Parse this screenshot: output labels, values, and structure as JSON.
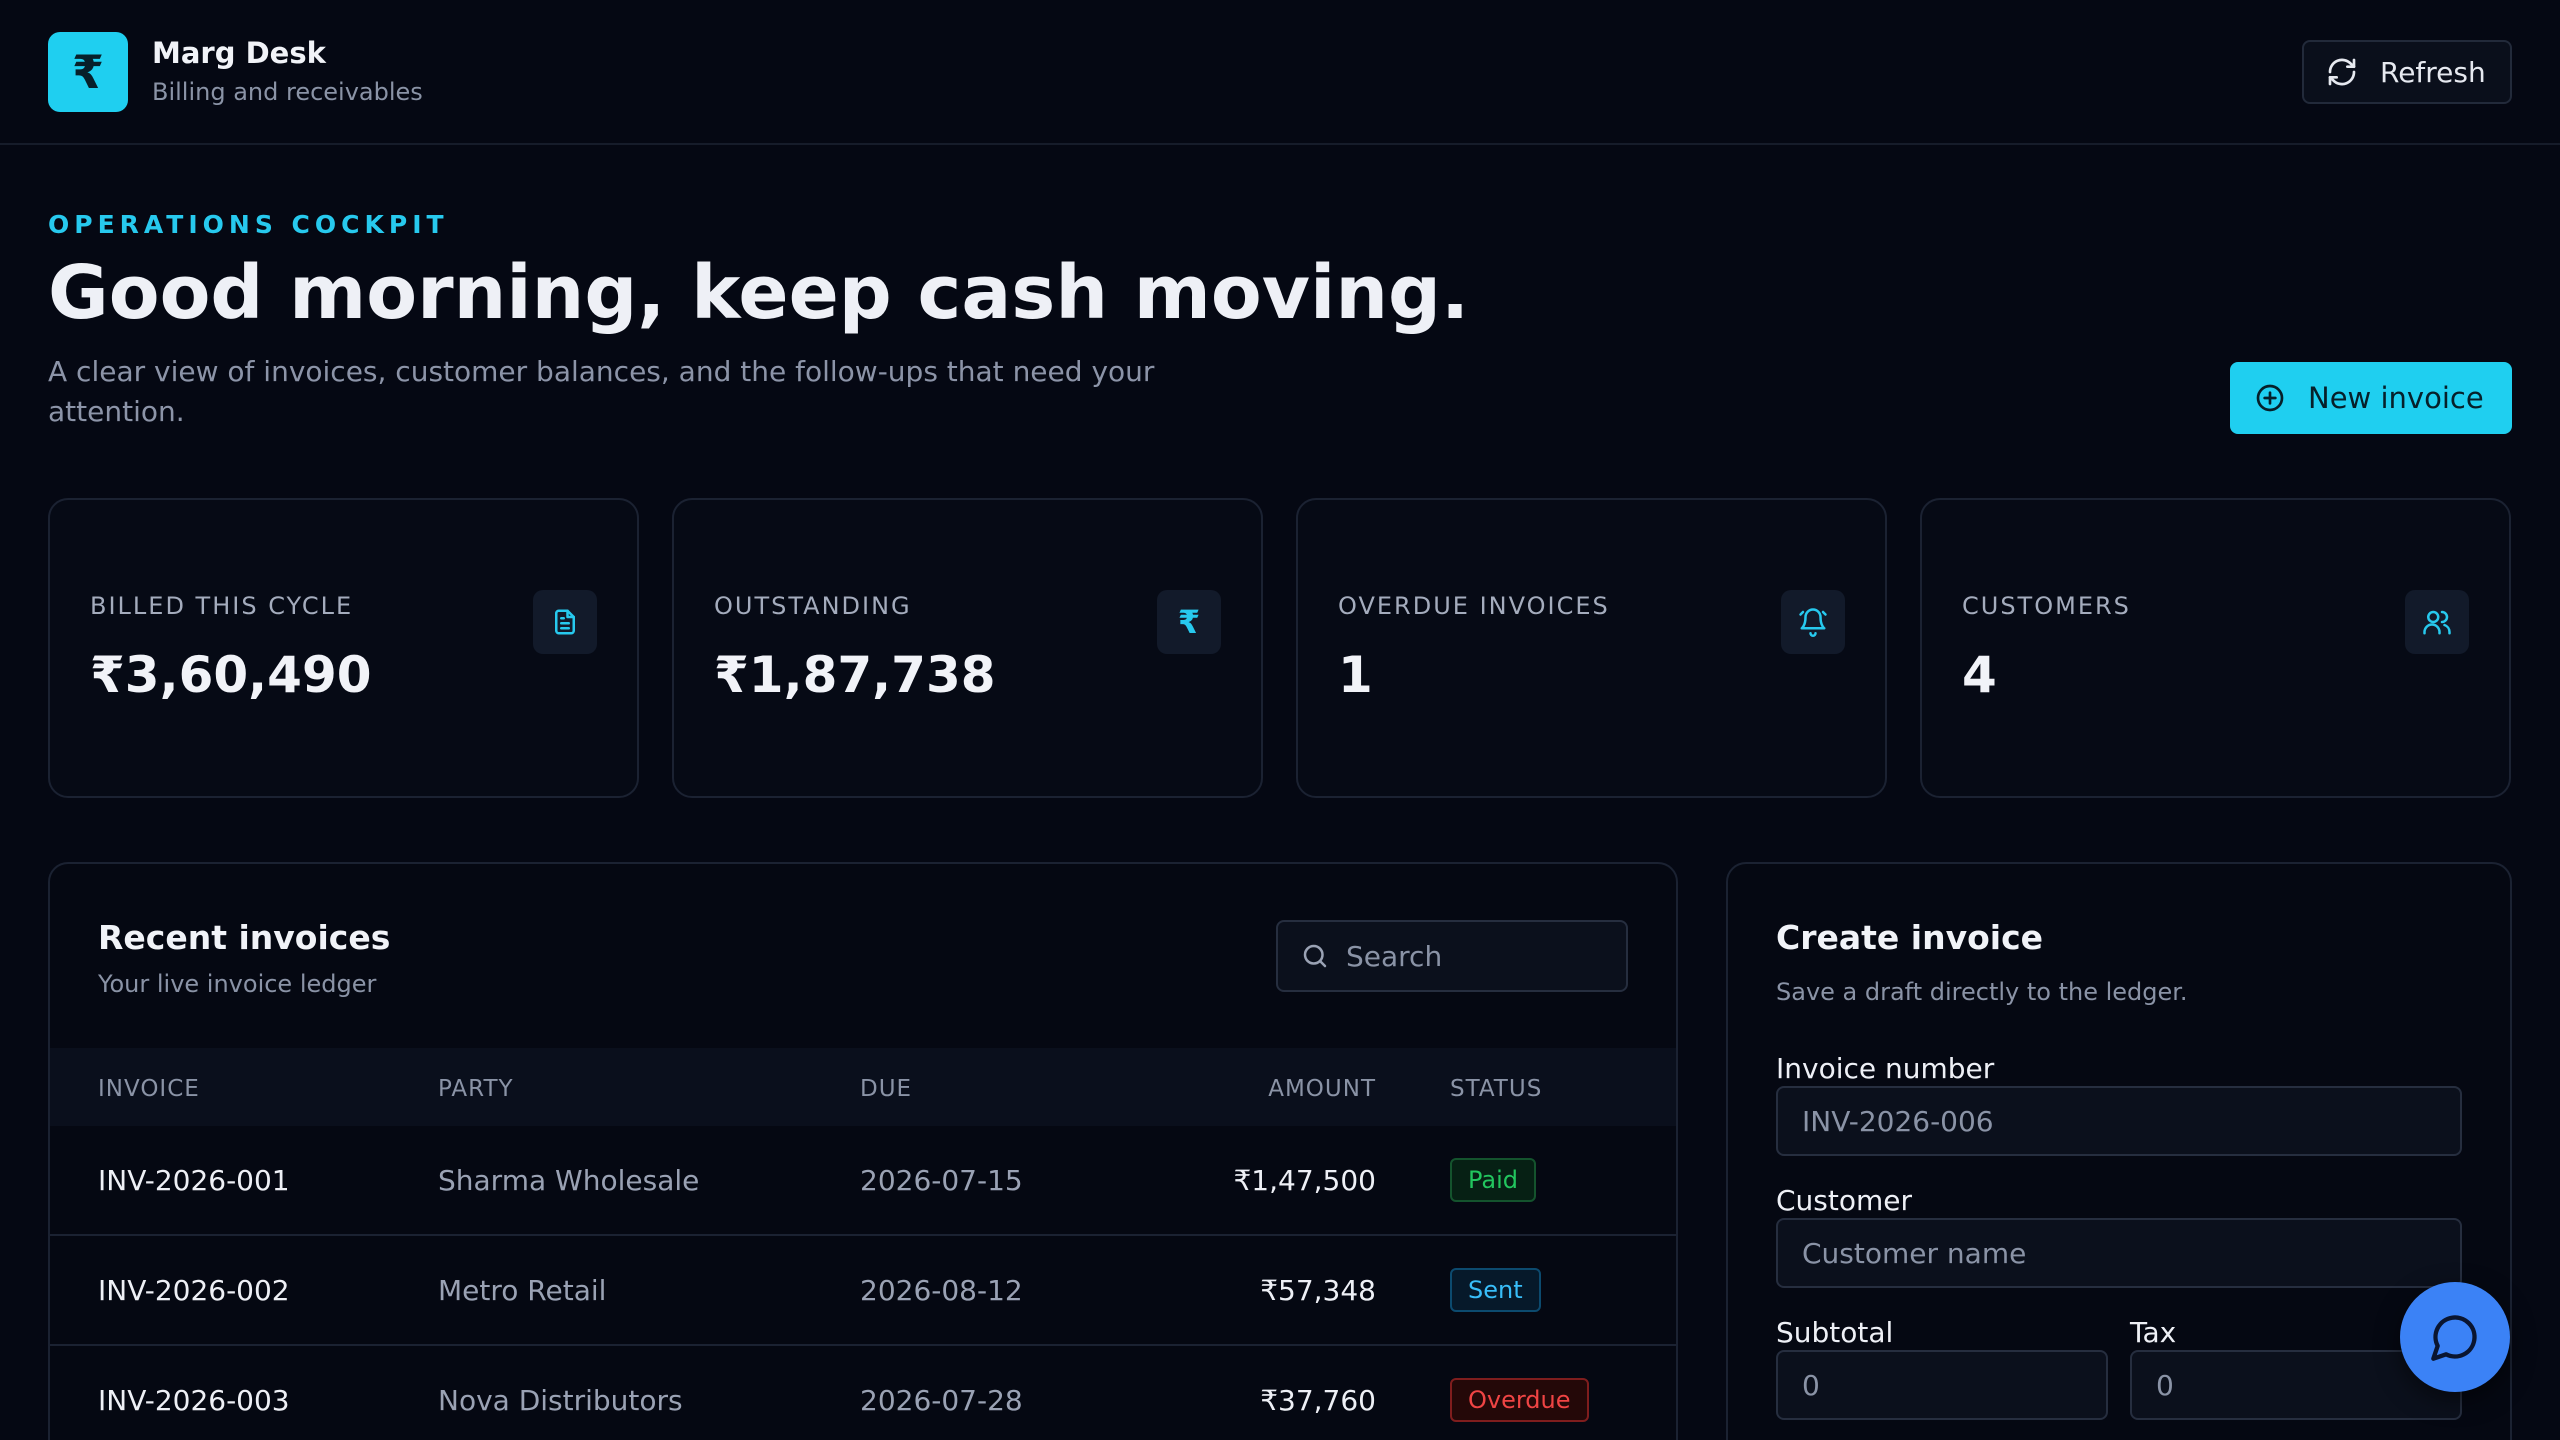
{
  "app": {
    "name": "Marg Desk",
    "subtitle": "Billing and receivables",
    "logo_glyph": "₹",
    "refresh_label": "Refresh"
  },
  "hero": {
    "eyebrow": "OPERATIONS COCKPIT",
    "title": "Good morning, keep cash moving.",
    "description": "A clear view of invoices, customer balances, and the follow-ups that need your attention.",
    "new_invoice_label": "New invoice"
  },
  "stats": [
    {
      "label": "BILLED THIS CYCLE",
      "value": "₹3,60,490",
      "icon": "document-icon"
    },
    {
      "label": "OUTSTANDING",
      "value": "₹1,87,738",
      "icon": "rupee-icon"
    },
    {
      "label": "OVERDUE INVOICES",
      "value": "1",
      "icon": "bell-icon"
    },
    {
      "label": "CUSTOMERS",
      "value": "4",
      "icon": "users-icon"
    }
  ],
  "invoices": {
    "title": "Recent invoices",
    "subtitle": "Your live invoice ledger",
    "search_placeholder": "Search",
    "columns": {
      "invoice": "INVOICE",
      "party": "PARTY",
      "due": "DUE",
      "amount": "AMOUNT",
      "status": "STATUS"
    },
    "rows": [
      {
        "invoice": "INV-2026-001",
        "party": "Sharma Wholesale",
        "due": "2026-07-15",
        "amount": "₹1,47,500",
        "status": "Paid"
      },
      {
        "invoice": "INV-2026-002",
        "party": "Metro Retail",
        "due": "2026-08-12",
        "amount": "₹57,348",
        "status": "Sent"
      },
      {
        "invoice": "INV-2026-003",
        "party": "Nova Distributors",
        "due": "2026-07-28",
        "amount": "₹37,760",
        "status": "Overdue"
      }
    ]
  },
  "create": {
    "title": "Create invoice",
    "subtitle": "Save a draft directly to the ledger.",
    "invoice_number_label": "Invoice number",
    "invoice_number_placeholder": "INV-2026-006",
    "customer_label": "Customer",
    "customer_placeholder": "Customer name",
    "subtotal_label": "Subtotal",
    "subtotal_placeholder": "0",
    "tax_label": "Tax",
    "tax_placeholder": "0"
  },
  "colors": {
    "accent": "#1fcff0",
    "paid": "#22c55e",
    "sent": "#38bdf8",
    "overdue": "#ef4444",
    "chat": "#3b82f6"
  }
}
